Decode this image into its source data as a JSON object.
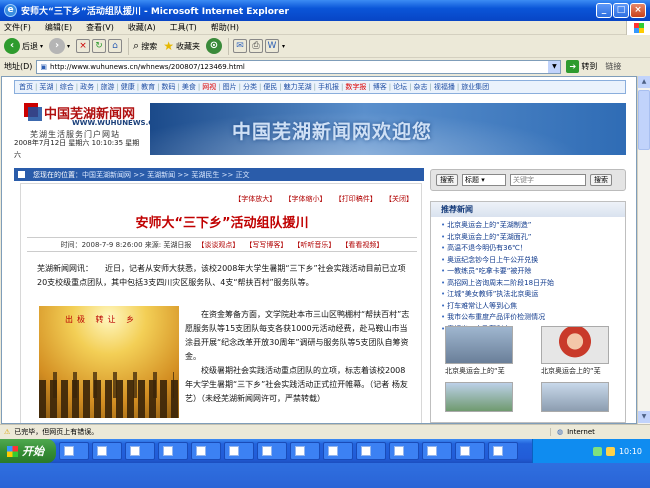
{
  "window": {
    "title": "安师大“三下乡”活动组队援川 - Microsoft Internet Explorer"
  },
  "menu": [
    "文件(F)",
    "编辑(E)",
    "查看(V)",
    "收藏(A)",
    "工具(T)",
    "帮助(H)"
  ],
  "toolbar": {
    "back": "后退",
    "search": "搜索",
    "favorites": "收藏夹"
  },
  "address": {
    "label": "地址(D)",
    "url": "http://www.wuhunews.cn/whnews/200807/123469.html",
    "go": "转到",
    "links": "链接"
  },
  "site": {
    "nav": [
      "首页",
      "芜湖",
      "综合",
      "政务",
      "旅游",
      "健康",
      "教育",
      "数码",
      "美食",
      "网视",
      "图片",
      "分类",
      "便民",
      "魅力芜湖",
      "手机报",
      "数字报",
      "博客",
      "论坛",
      "杂志",
      "视福播",
      "旅业集团"
    ],
    "logo_name": "中国芜湖新闻网",
    "logo_url": "WWW.WUHUNEWS.CN",
    "slogan": "芜湖生活服务门户网站",
    "date": "2008年7月12日 星期六 10:10:35 星期六",
    "banner": "中国芜湖新闻网欢迎您",
    "breadcrumb": {
      "prefix": "您现在的位置：",
      "path": "中国芜湖新闻网 >> 芜湖新闻 >> 芜湖民生 >> 正文"
    }
  },
  "article": {
    "tools": [
      "【字体放大】",
      "【字体缩小】",
      "【打印稿件】",
      "【关闭】"
    ],
    "title": "安师大“三下乡”活动组队援川",
    "meta": "时间：2008-7-9 8:26:00 来源: 芜湖日报",
    "meta_links": [
      "【谈谈观点】",
      "【写写博客】",
      "【听听音乐】",
      "【看看视频】"
    ],
    "lead": "芜湖新闻网讯：　　近日，记者从安师大获悉，该校2008年大学生暑期“三下乡”社会实践活动目前已立项20支校级重点团队，其中包括3支四川灾区服务队、4支“帮扶百村”服务队等。",
    "photo_text": "出极  转让  乡",
    "p2": "在资金筹备方面，文学院赴本市三山区鸭棚村“帮扶百村”志愿服务队等15支团队每支各获1000元活动经费，赴马鞍山市当涂县开展“纪念改革开放30周年”调研与服务队等5支团队自筹资金。",
    "p3": "校级暑期社会实践活动重点团队的立项，标志着该校2008年大学生暑期“三下乡”社会实践活动正式拉开帷幕。（记者 杨友艺）（未经芜湖新闻网许可，严禁转载）"
  },
  "search": {
    "button": "搜索",
    "select": "标题",
    "placeholder": "关键字",
    "submit": "搜索"
  },
  "recent": {
    "heading": "推荐新闻",
    "items": [
      "北京奥运会上的“芜湖制造”",
      "北京奥运会上的“芜湖面孔”",
      "高温不退今明仍有36℃！",
      "奥运纪念钞今日上午公开兑换",
      "一教练员“吃拿卡要”被开除",
      "高招网上咨询周末二阶段18日开始",
      "江城“美女教师”执法北京奥运",
      "打车难常让人等到心焦",
      "我市公布重度产品评价检测情况",
      "青铜出口实及郭利变"
    ],
    "captions": [
      "北京奥运会上的“芜",
      "北京奥运会上的“芜"
    ]
  },
  "status": {
    "text": "已完毕，但网页上有错误。",
    "zone": "Internet"
  },
  "taskbar": {
    "start": "开始",
    "clock": "10:10"
  }
}
